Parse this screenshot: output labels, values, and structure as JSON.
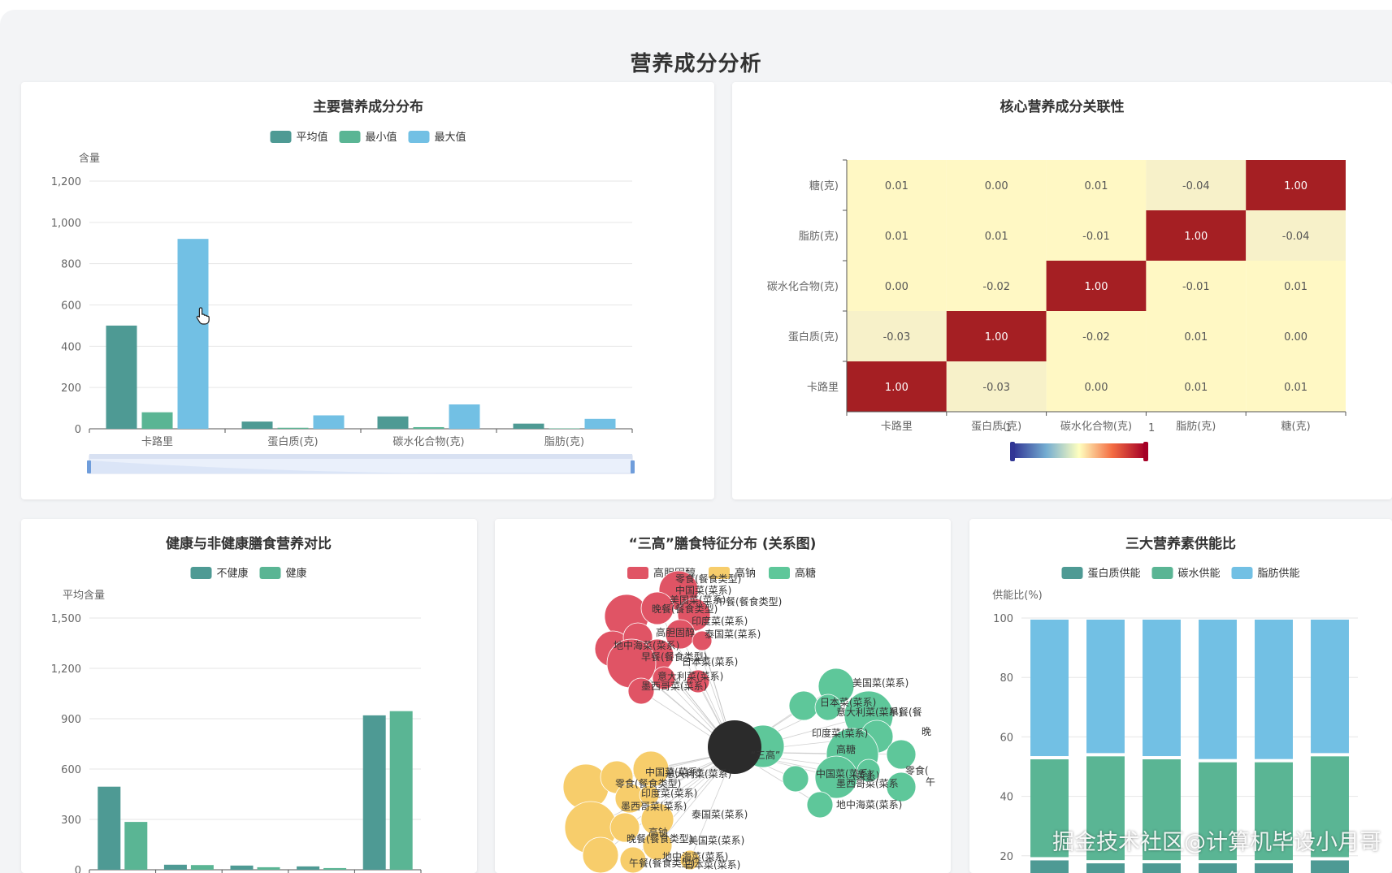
{
  "page": {
    "title": "营养成分分析",
    "watermark": "掘金技术社区@计算机毕设小月哥"
  },
  "colors": {
    "bg": "#f3f4f6",
    "c1": "#4e9a94",
    "c2": "#5ab594",
    "c3": "#72c0e4",
    "hm_low": "#fff8c4",
    "hm_high": "#a51f23",
    "red": "#e05465",
    "yellow": "#f7cd6b",
    "green": "#5ec79a",
    "dark": "#2b2b2b"
  },
  "icons": {
    "cursor": "hand-pointer-icon"
  },
  "chart_data": [
    {
      "type": "bar",
      "title": "主要营养成分分布",
      "ylabel": "含量",
      "ylim": [
        0,
        1200
      ],
      "yticks": [
        "0",
        "200",
        "400",
        "600",
        "800",
        "1,000",
        "1,200"
      ],
      "categories": [
        "卡路里",
        "蛋白质(克)",
        "碳水化合物(克)",
        "脂肪(克)"
      ],
      "series": [
        {
          "name": "平均值",
          "color": "#4e9a94",
          "values": [
            500,
            35,
            60,
            25
          ]
        },
        {
          "name": "最小值",
          "color": "#5ab594",
          "values": [
            80,
            5,
            8,
            2
          ]
        },
        {
          "name": "最大值",
          "color": "#72c0e4",
          "values": [
            920,
            65,
            118,
            48
          ]
        }
      ],
      "legend": "top-center",
      "data_zoom": true
    },
    {
      "type": "heatmap",
      "title": "核心营养成分关联性",
      "x_categories": [
        "卡路里",
        "蛋白质(克)",
        "碳水化合物(克)",
        "脂肪(克)",
        "糖(克)"
      ],
      "y_categories": [
        "卡路里",
        "蛋白质(克)",
        "碳水化合物(克)",
        "脂肪(克)",
        "糖(克)"
      ],
      "values": [
        [
          1.0,
          -0.03,
          0.0,
          0.01,
          0.01
        ],
        [
          -0.03,
          1.0,
          -0.02,
          0.01,
          0.0
        ],
        [
          0.0,
          -0.02,
          1.0,
          -0.01,
          0.01
        ],
        [
          0.01,
          0.01,
          -0.01,
          1.0,
          -0.04
        ],
        [
          0.01,
          0.0,
          0.01,
          -0.04,
          1.0
        ]
      ],
      "labels": [
        [
          "1.00",
          "-0.03",
          "0.00",
          "0.01",
          "0.01"
        ],
        [
          "-0.03",
          "1.00",
          "-0.02",
          "0.01",
          "0.00"
        ],
        [
          "0.00",
          "-0.02",
          "1.00",
          "-0.01",
          "0.01"
        ],
        [
          "0.01",
          "0.01",
          "-0.01",
          "1.00",
          "-0.04"
        ],
        [
          "0.01",
          "0.00",
          "0.01",
          "-0.04",
          "1.00"
        ]
      ],
      "visual_map": {
        "min_label": "-1",
        "max_label": "1"
      }
    },
    {
      "type": "bar",
      "title": "健康与非健康膳食营养对比",
      "ylabel": "平均含量",
      "ylim": [
        0,
        1500
      ],
      "yticks": [
        "0",
        "300",
        "600",
        "900",
        "1,200",
        "1,500"
      ],
      "categories": [
        "",
        "",
        "",
        "",
        ""
      ],
      "series": [
        {
          "name": "不健康",
          "color": "#4e9a94",
          "values": [
            495,
            30,
            25,
            20,
            920
          ]
        },
        {
          "name": "健康",
          "color": "#5ab594",
          "values": [
            285,
            28,
            15,
            10,
            945
          ]
        }
      ],
      "legend": "top-center"
    },
    {
      "type": "network",
      "title": "“三高”膳食特征分布 (关系图)",
      "legend": [
        {
          "name": "高胆固醇",
          "color": "#e05465"
        },
        {
          "name": "高钠",
          "color": "#f7cd6b"
        },
        {
          "name": "高糖",
          "color": "#5ec79a"
        }
      ],
      "center_label": "“三高”",
      "groups": [
        {
          "category": "高胆固醇",
          "nodes": [
            "零食(餐食类型)",
            "中国菜(菜系)",
            "美国菜(菜系)",
            "晚餐(餐食类型)",
            "午餐(餐食类型)",
            "印度菜(菜系)",
            "高胆固醇",
            "泰国菜(菜系)",
            "地中海菜(菜系)",
            "早餐(餐食类型)",
            "日本菜(菜系)",
            "意大利菜(菜系)",
            "墨西哥菜(菜系)"
          ]
        },
        {
          "category": "高糖",
          "nodes": [
            "美国菜(菜系)",
            "日本菜(菜系)",
            "意大利菜(菜系)",
            "早餐(餐",
            "晚",
            "印度菜(菜系)",
            "高糖",
            "零食(",
            "中国菜(菜系)",
            "(菜系)",
            "午",
            "墨西哥菜(菜系",
            "地中海菜(菜系)"
          ]
        },
        {
          "category": "高钠",
          "nodes": [
            "中国菜(菜系)",
            "意大利菜(菜系)",
            "印度菜(菜系)",
            "零食(餐食类型)",
            "墨西哥菜(菜系)",
            "泰国菜(菜系)",
            "高钠",
            "晚餐(餐食类型)",
            "美国菜(菜系)",
            "地中海菜(菜系)",
            "午餐(餐食类型)",
            "日本菜(菜系)"
          ]
        }
      ]
    },
    {
      "type": "bar",
      "title": "三大营养素供能比",
      "ylabel": "供能比(%)",
      "ylim": [
        0,
        100
      ],
      "yticks": [
        "20",
        "40",
        "60",
        "80",
        "100"
      ],
      "categories": [
        "",
        "",
        "",
        "",
        "",
        ""
      ],
      "stacked": true,
      "series": [
        {
          "name": "蛋白质供能",
          "color": "#4e9a94",
          "values": [
            19,
            18,
            18,
            18,
            18,
            19
          ]
        },
        {
          "name": "碳水供能",
          "color": "#5ab594",
          "values": [
            34,
            36,
            35,
            34,
            34,
            35
          ]
        },
        {
          "name": "脂肪供能",
          "color": "#72c0e4",
          "values": [
            47,
            46,
            47,
            48,
            48,
            46
          ]
        }
      ],
      "legend": "top-center"
    }
  ]
}
